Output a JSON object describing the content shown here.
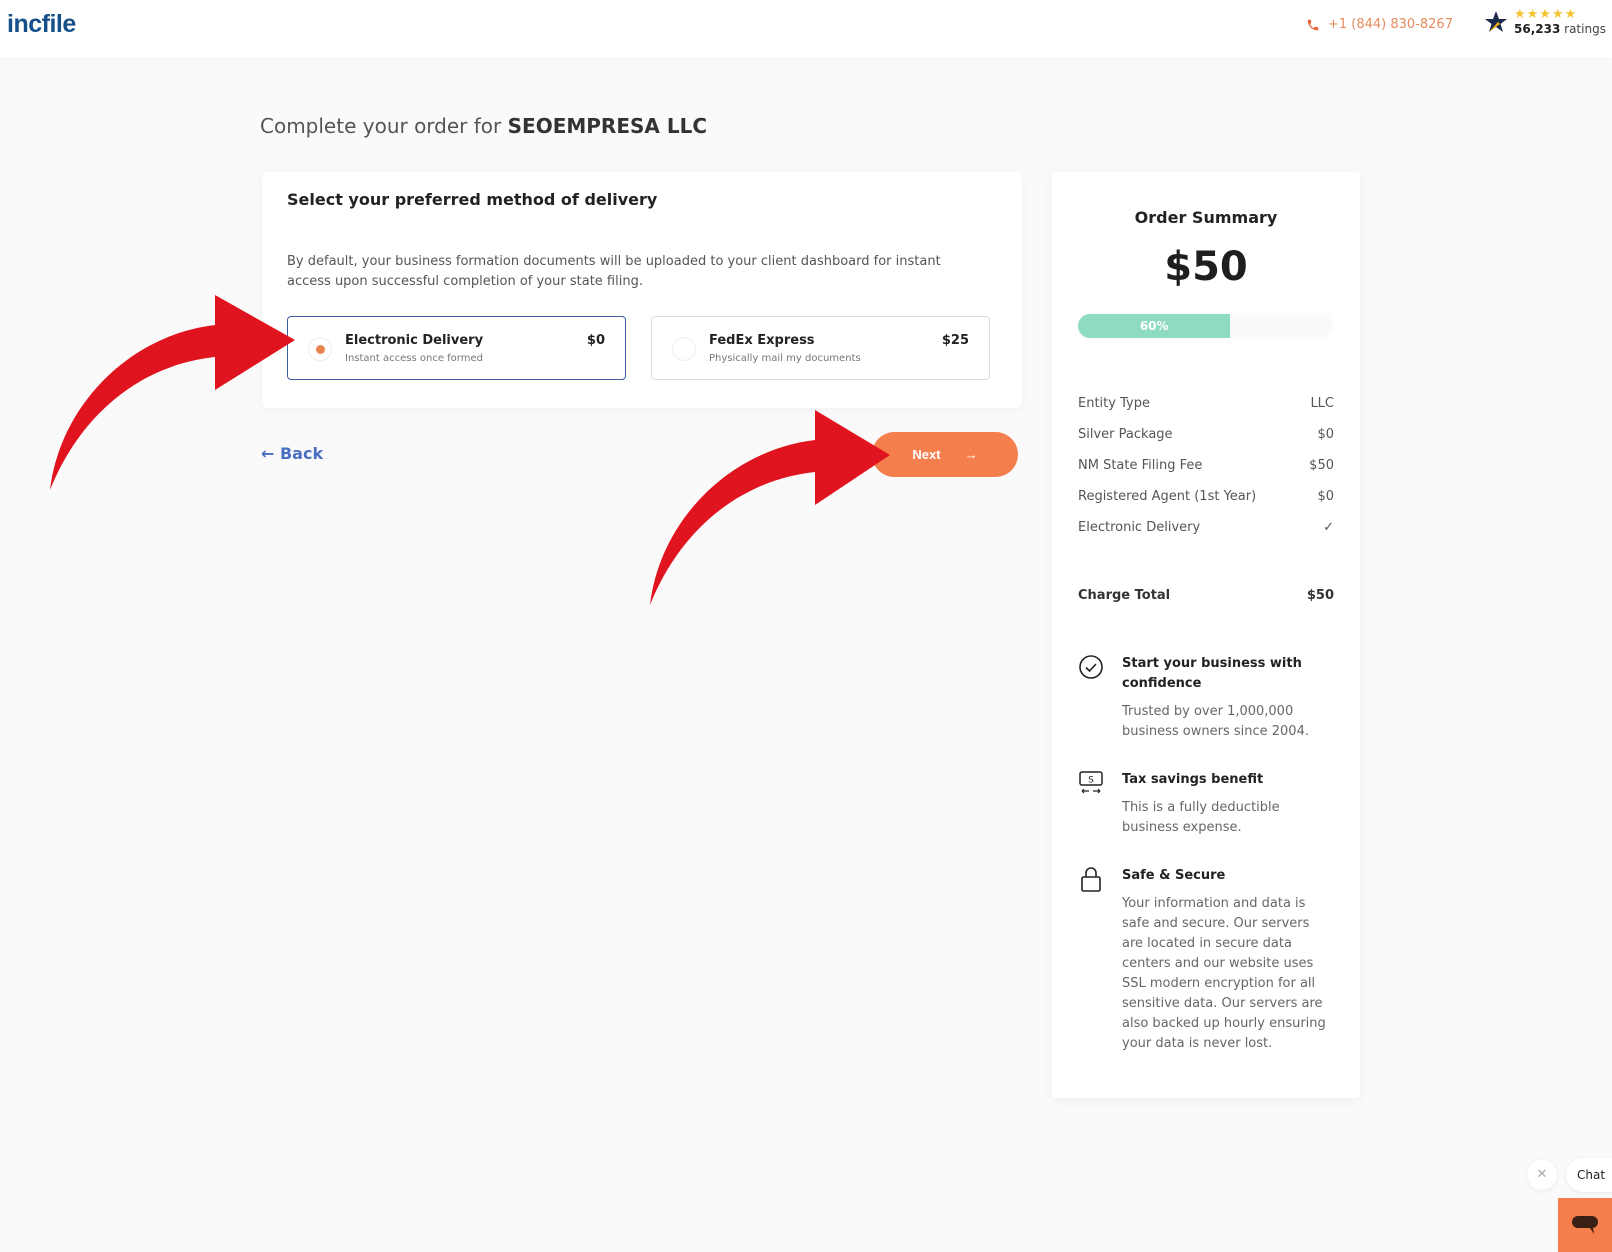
{
  "header": {
    "logo": "incfile",
    "phone": "+1 (844) 830-8267",
    "rating_stars": "★★★★★",
    "rating_count": "56,233",
    "rating_label": "ratings"
  },
  "page": {
    "title_prefix": "Complete your order for",
    "company_name": "SEOEMPRESA LLC"
  },
  "delivery": {
    "heading": "Select your preferred method of delivery",
    "description": "By default, your business formation documents will be uploaded to your client dashboard for instant access upon successful completion of your state filing.",
    "options": [
      {
        "title": "Electronic Delivery",
        "subtitle": "Instant access once formed",
        "price": "$0",
        "selected": true
      },
      {
        "title": "FedEx Express",
        "subtitle": "Physically mail my documents",
        "price": "$25",
        "selected": false
      }
    ]
  },
  "nav": {
    "back_label": "Back",
    "back_icon": "←",
    "next_label": "Next",
    "next_icon": "→"
  },
  "summary": {
    "title": "Order Summary",
    "price": "$50",
    "progress_label": "60%",
    "progress_value": 60,
    "progress_color": "#8edcc0",
    "items": [
      {
        "label": "Entity Type",
        "value": "LLC"
      },
      {
        "label": "Silver Package",
        "value": "$0"
      },
      {
        "label": "NM State Filing Fee",
        "value": "$50"
      },
      {
        "label": "Registered Agent (1st Year)",
        "value": "$0"
      },
      {
        "label": "Electronic Delivery",
        "value": "✓"
      }
    ],
    "total_label": "Charge Total",
    "total_value": "$50",
    "benefits": [
      {
        "icon": "check-circle-icon",
        "title": "Start your business with confidence",
        "text": "Trusted by over 1,000,000 business owners since 2004."
      },
      {
        "icon": "money-transfer-icon",
        "title": "Tax savings benefit",
        "text": "This is a fully deductible business expense."
      },
      {
        "icon": "lock-icon",
        "title": "Safe & Secure",
        "text": "Your information and data is safe and secure. Our servers are located in secure data centers and our website uses SSL modern encryption for all sensitive data. Our servers are also backed up hourly ensuring your data is never lost."
      }
    ]
  },
  "chat": {
    "label": "Chat",
    "close_icon": "✕"
  },
  "colors": {
    "accent": "#f47f4d",
    "brand": "#16508a",
    "link": "#4a6fc0",
    "annotation_arrow": "#e0141e"
  }
}
